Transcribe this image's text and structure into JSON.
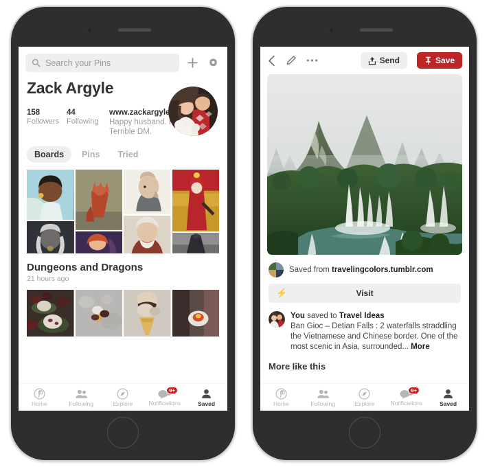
{
  "left_phone": {
    "search": {
      "placeholder": "Search your Pins",
      "icon": "search-icon"
    },
    "add_icon": "plus-icon",
    "settings_icon": "gear-icon",
    "profile_name": "Zack Argyle",
    "avatar": "couple-photo-avatar",
    "stats": [
      {
        "number": "158",
        "label": "Followers"
      },
      {
        "number": "44",
        "label": "Following"
      }
    ],
    "bio": {
      "url": "www.zackargyle.com",
      "text": "Happy husband. Proud dad. Terrible DM."
    },
    "tabs": [
      {
        "label": "Boards",
        "active": true
      },
      {
        "label": "Pins",
        "active": false
      },
      {
        "label": "Tried",
        "active": false
      }
    ],
    "boards": [
      {
        "title": "Dungeons and Dragons",
        "time": "21 hours ago"
      }
    ]
  },
  "right_phone": {
    "toolbar": {
      "back_icon": "chevron-left-icon",
      "edit_icon": "pencil-icon",
      "more_icon": "ellipsis-icon",
      "send_label": "Send",
      "send_icon": "share-upload-icon",
      "save_label": "Save",
      "save_icon": "pin-icon"
    },
    "hero_image": "ban-gioc-detian-waterfalls-photo",
    "source": {
      "prefix": "Saved from ",
      "domain": "travelingcolors.tumblr.com",
      "avatar": "tumblr-collage-avatar"
    },
    "visit": {
      "label": "Visit",
      "icon": "lightning-bolt-icon"
    },
    "description": {
      "actor": "You",
      "saved_to_prefix": " saved to ",
      "board": "Travel Ideas",
      "body": "Ban Gioc – Detian Falls : 2 waterfalls straddling the Vietnamese and Chinese border. One of the most scenic in Asia, surrounded... ",
      "more": "More"
    },
    "more_like_this": "More like this"
  },
  "tabbar": {
    "items": [
      {
        "label": "Home",
        "icon": "pinterest-icon",
        "active": false,
        "badge": ""
      },
      {
        "label": "Following",
        "icon": "people-icon",
        "active": false,
        "badge": ""
      },
      {
        "label": "Explore",
        "icon": "compass-icon",
        "active": false,
        "badge": ""
      },
      {
        "label": "Notifications",
        "icon": "chat-bubbles-icon",
        "active": false,
        "badge": "9+"
      },
      {
        "label": "Saved",
        "icon": "person-icon",
        "active": true,
        "badge": ""
      }
    ]
  },
  "colors": {
    "brand_red": "#bd2626",
    "badge_red": "#cc2127",
    "chip_gray": "#efefef",
    "text_dark": "#333333",
    "text_muted": "#9b9b9b"
  }
}
